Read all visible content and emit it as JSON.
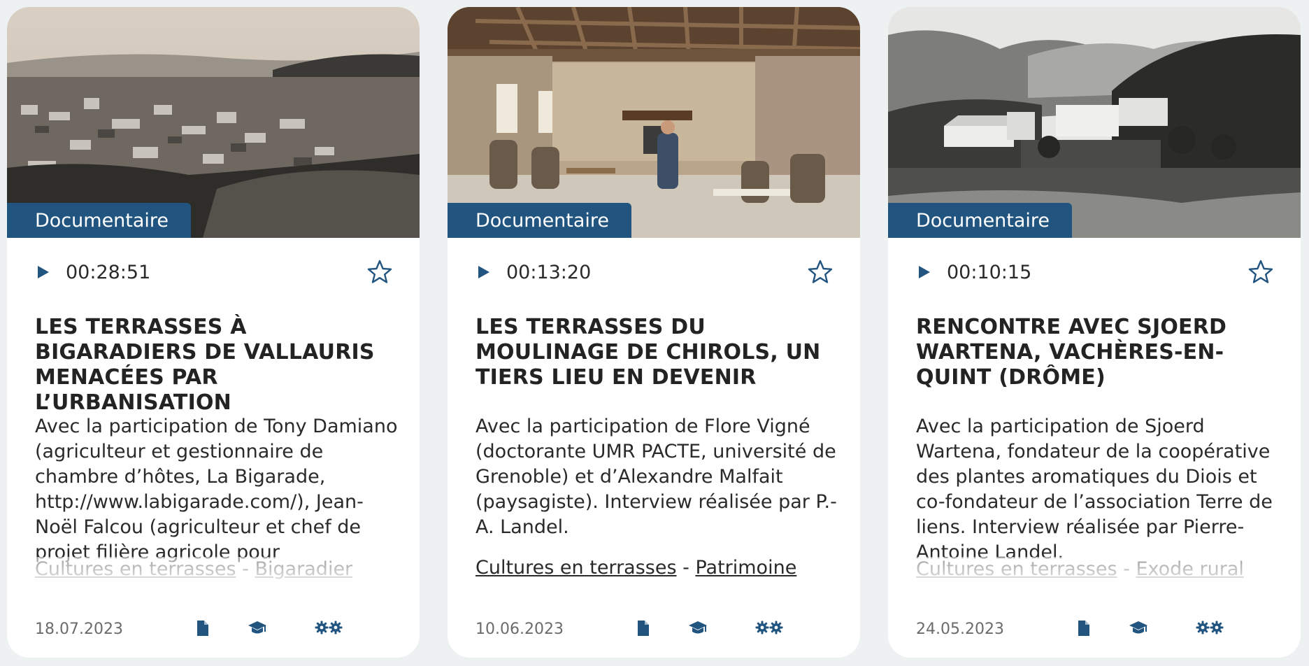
{
  "colors": {
    "accent": "#215580",
    "background": "#eef1f2",
    "card": "#ffffff"
  },
  "cards": [
    {
      "badge": "Documentaire",
      "duration": "00:28:51",
      "title": "LES TERRASSES À BIGARADIERS DE VALLAURIS MENACÉES PAR L’URBANISATION",
      "description": "Avec la participation de Tony Damiano (agriculteur et gestionnaire de chambre d’hôtes, La Bigarade, http://www.labigarade.com/), Jean-Noël Falcou (agriculteur et chef de projet filière agricole pour",
      "tags": {
        "first": "Cultures en terrasses",
        "separator": " - ",
        "second": "Bigaradier"
      },
      "date": "18.07.2023",
      "icons": [
        "play-icon",
        "star-icon",
        "document-icon",
        "graduation-cap-icon",
        "gears-icon"
      ]
    },
    {
      "badge": "Documentaire",
      "duration": "00:13:20",
      "title": "LES TERRASSES DU MOULINAGE DE CHIROLS, UN TIERS LIEU EN DEVENIR",
      "description": "Avec la participation de Flore Vigné (doctorante UMR PACTE, université de Grenoble) et d’Alexandre Malfait (paysagiste). Interview réalisée par P.-A. Landel.",
      "tags": {
        "first": "Cultures en terrasses",
        "separator": " - ",
        "second": "Patrimoine"
      },
      "date": "10.06.2023",
      "icons": [
        "play-icon",
        "star-icon",
        "document-icon",
        "graduation-cap-icon",
        "gears-icon"
      ]
    },
    {
      "badge": "Documentaire",
      "duration": "00:10:15",
      "title": "RENCONTRE AVEC SJOERD WARTENA, VACHÈRES-EN-QUINT (DRÔME)",
      "description": "Avec la participation de Sjoerd Wartena, fondateur de la coopérative des plantes aromatiques du Diois et co-fondateur de l’association Terre de liens. Interview réalisée par Pierre-Antoine Landel.",
      "tags": {
        "first": "Cultures en terrasses",
        "separator": " - ",
        "second": "Exode rural"
      },
      "date": "24.05.2023",
      "icons": [
        "play-icon",
        "star-icon",
        "document-icon",
        "graduation-cap-icon",
        "gears-icon"
      ]
    }
  ]
}
